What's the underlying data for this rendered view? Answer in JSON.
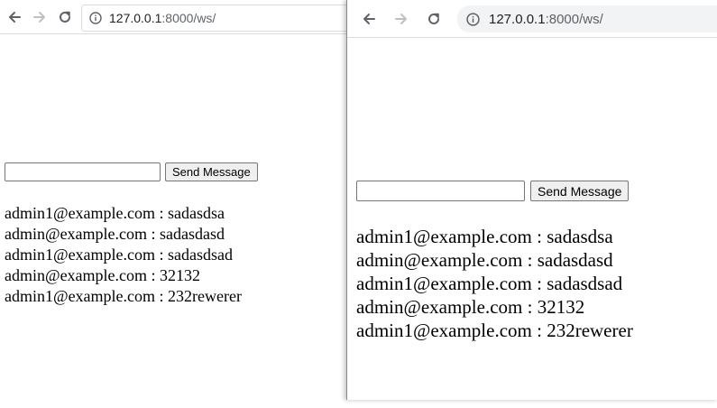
{
  "windows": [
    {
      "url_host": "127.0.0.1",
      "url_rest": ":8000/ws/",
      "send_label": "Send Message",
      "input_value": "",
      "messages": [
        "admin1@example.com : sadasdsa",
        "admin@example.com : sadasdasd",
        "admin1@example.com : sadasdsad",
        "admin@example.com : 32132",
        "admin1@example.com : 232rewerer"
      ]
    },
    {
      "url_host": "127.0.0.1",
      "url_rest": ":8000/ws/",
      "send_label": "Send Message",
      "input_value": "",
      "messages": [
        "admin1@example.com : sadasdsa",
        "admin@example.com : sadasdasd",
        "admin1@example.com : sadasdsad",
        "admin@example.com : 32132",
        "admin1@example.com : 232rewerer"
      ]
    }
  ],
  "icons": {
    "back": "back-arrow-icon",
    "forward": "forward-arrow-icon",
    "reload": "reload-icon",
    "info": "info-icon"
  },
  "colors": {
    "icon_active": "#5f6368",
    "icon_disabled": "#bdc1c6",
    "url_host": "#202124",
    "url_rest": "#5f6368",
    "omnibox_bg": "#f1f3f4"
  }
}
